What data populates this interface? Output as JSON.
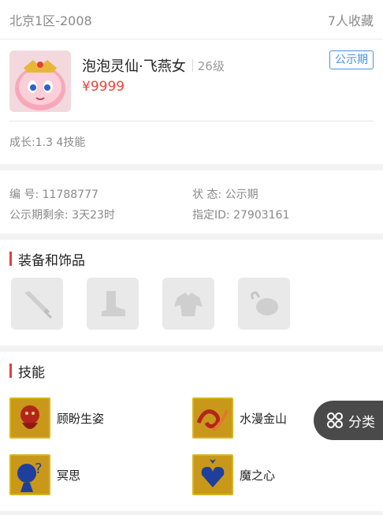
{
  "header": {
    "server": "北京1区-2008",
    "favorites": "7人收藏"
  },
  "pet": {
    "name": "泡泡灵仙·飞燕女",
    "level": "26级",
    "price": "¥9999",
    "status": "公示期",
    "growth": "成长:1.3 4技能"
  },
  "info": {
    "id_label": "编 号:",
    "id_value": "11788777",
    "state_label": "状 态:",
    "state_value": "公示期",
    "remain_label": "公示期剩余:",
    "remain_value": "3天23时",
    "assign_label": "指定ID:",
    "assign_value": "27903161"
  },
  "equipment": {
    "title": "装备和饰品",
    "slots": [
      {
        "icon": "sword-icon"
      },
      {
        "icon": "boot-icon"
      },
      {
        "icon": "armor-icon"
      },
      {
        "icon": "pouch-icon"
      }
    ]
  },
  "skills": {
    "title": "技能",
    "items": [
      {
        "name": "顾盼生姿",
        "icon": "demon-skill-icon"
      },
      {
        "name": "水漫金山",
        "icon": "wave-skill-icon"
      },
      {
        "name": "冥思",
        "icon": "meditate-skill-icon"
      },
      {
        "name": "魔之心",
        "icon": "heart-skill-icon"
      }
    ]
  },
  "float_button": {
    "label": "分类",
    "icon": "grid-icon"
  }
}
